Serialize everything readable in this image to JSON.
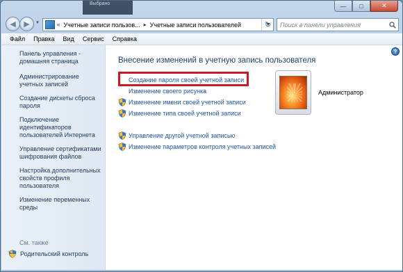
{
  "window": {
    "background_item": "Выбрано"
  },
  "caption_buttons": {
    "minimize": "—",
    "maximize": "□",
    "close": "✕"
  },
  "nav": {
    "back_icon": "arrow-left-icon",
    "forward_icon": "arrow-right-icon",
    "breadcrumb": [
      "Учетные записи пользов...",
      "Учетные записи пользователей"
    ],
    "refresh_icon": "refresh-icon",
    "search_placeholder": "Поиск в панели управления"
  },
  "menu": {
    "items": [
      "Файл",
      "Правка",
      "Вид",
      "Сервис",
      "Справка"
    ]
  },
  "sidebar": {
    "items": [
      "Панель управления - домашняя страница",
      "Администрирование учетных записей",
      "Создание дискеты сброса пароля",
      "Подключение идентификаторов пользователей Интернета",
      "Управление сертификатами шифрования файлов",
      "Настройка дополнительных свойств профиля пользователя",
      "Изменение переменных среды"
    ],
    "see_also": "См. также",
    "parental_control": "Родительский контроль"
  },
  "main": {
    "title": "Внесение изменений в учетную запись пользователя",
    "tasks": [
      {
        "label": "Создание пароля своей учетной записи",
        "shield": false
      },
      {
        "label": "Изменение своего рисунка",
        "shield": false
      },
      {
        "label": "Изменение имени своей учетной записи",
        "shield": true
      },
      {
        "label": "Изменение типа своей учетной записи",
        "shield": true
      }
    ],
    "other_tasks": [
      {
        "label": "Управление другой учетной записью",
        "shield": true
      },
      {
        "label": "Изменение параметров контроля учетных записей",
        "shield": true
      }
    ],
    "highlight_color": "#cc1b24",
    "user": {
      "name": "Администратор"
    }
  },
  "colors": {
    "link": "#1a56b0",
    "title": "#1e3f6b",
    "sidebar_link": "#1e395b"
  }
}
